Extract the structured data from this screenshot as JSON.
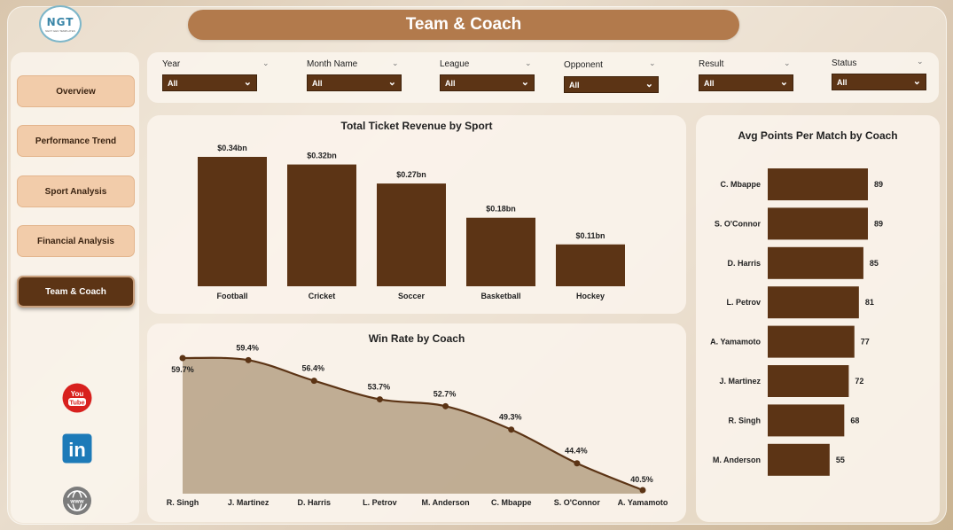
{
  "app": {
    "title": "Team & Coach",
    "logo_text": "NGT",
    "logo_subtext": "NEXT GEN TEMPLATES"
  },
  "nav": {
    "items": [
      {
        "label": "Overview",
        "active": false
      },
      {
        "label": "Performance Trend",
        "active": false
      },
      {
        "label": "Sport Analysis",
        "active": false
      },
      {
        "label": "Financial Analysis",
        "active": false
      },
      {
        "label": "Team & Coach",
        "active": true
      }
    ]
  },
  "social": [
    "youtube-icon",
    "linkedin-icon",
    "website-icon"
  ],
  "social_text": {
    "youtube_line1": "You",
    "youtube_line2": "Tube",
    "linkedin": "in",
    "website": "www"
  },
  "filters": [
    {
      "label": "Year",
      "value": "All"
    },
    {
      "label": "Month Name",
      "value": "All"
    },
    {
      "label": "League",
      "value": "All"
    },
    {
      "label": "Opponent",
      "value": "All"
    },
    {
      "label": "Result",
      "value": "All"
    },
    {
      "label": "Status",
      "value": "All"
    }
  ],
  "colors": {
    "bar": "#5c3415",
    "accent": "#b27a4c",
    "area": "#a8906f",
    "line": "#5c3415"
  },
  "chart_data": [
    {
      "type": "bar",
      "title": "Total Ticket Revenue by Sport",
      "categories": [
        "Football",
        "Cricket",
        "Soccer",
        "Basketball",
        "Hockey"
      ],
      "values": [
        0.34,
        0.32,
        0.27,
        0.18,
        0.11
      ],
      "data_labels": [
        "$0.34bn",
        "$0.32bn",
        "$0.27bn",
        "$0.18bn",
        "$0.11bn"
      ],
      "ylim": [
        0,
        0.34
      ]
    },
    {
      "type": "area",
      "title": "Win Rate by Coach",
      "categories": [
        "R. Singh",
        "J. Martinez",
        "D. Harris",
        "L. Petrov",
        "M. Anderson",
        "C. Mbappe",
        "S. O'Connor",
        "A. Yamamoto"
      ],
      "values": [
        59.7,
        59.4,
        56.4,
        53.7,
        52.7,
        49.3,
        44.4,
        40.5
      ],
      "data_labels": [
        "59.7%",
        "59.4%",
        "56.4%",
        "53.7%",
        "52.7%",
        "49.3%",
        "44.4%",
        "40.5%"
      ]
    },
    {
      "type": "bar",
      "orientation": "horizontal",
      "title": "Avg Points Per Match by Coach",
      "categories": [
        "C. Mbappe",
        "S. O'Connor",
        "D. Harris",
        "L. Petrov",
        "A. Yamamoto",
        "J. Martinez",
        "R. Singh",
        "M. Anderson"
      ],
      "values": [
        89,
        89,
        85,
        81,
        77,
        72,
        68,
        55
      ],
      "data_labels": [
        "89",
        "89",
        "85",
        "81",
        "77",
        "72",
        "68",
        "55"
      ],
      "xlim": [
        0,
        89
      ]
    }
  ]
}
